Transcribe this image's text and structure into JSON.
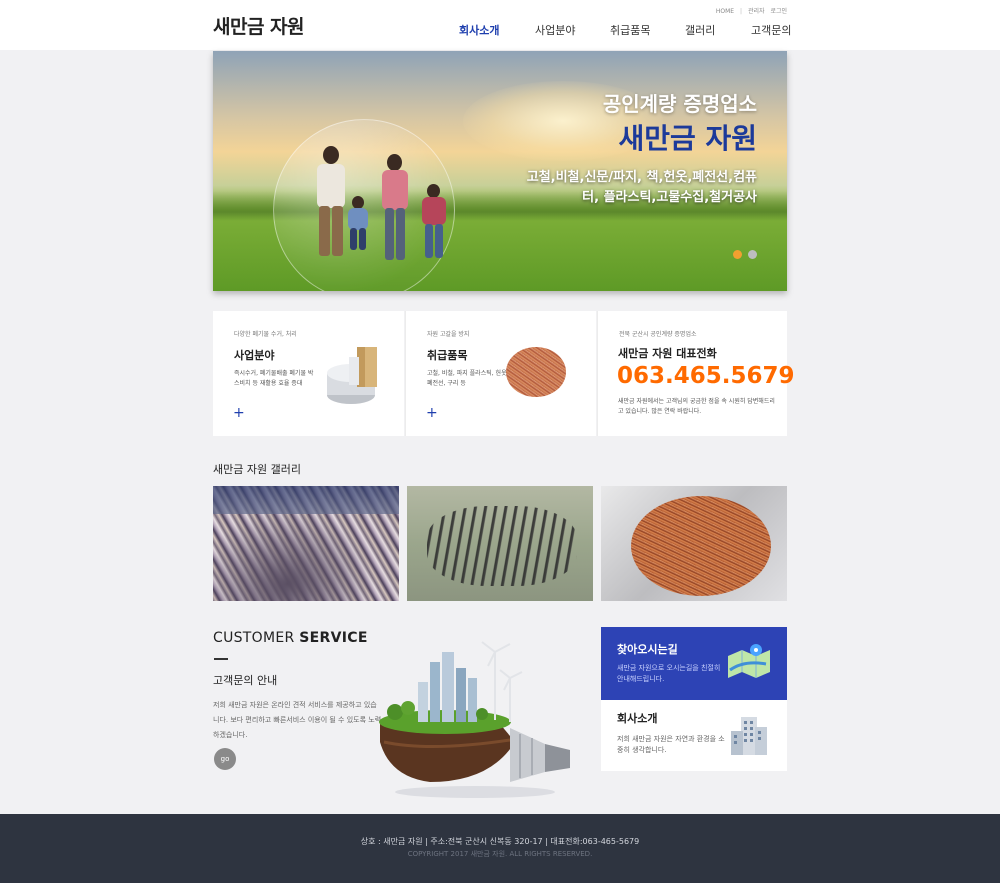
{
  "header": {
    "logo": "새만금 자원",
    "util": {
      "home": "HOME",
      "sep": "|",
      "admin": "관리자",
      "login": "로그인"
    },
    "nav": [
      "회사소개",
      "사업분야",
      "취급품목",
      "갤러리",
      "고객문의"
    ],
    "active_nav": 0
  },
  "banner": {
    "line1": "공인계량 증명업소",
    "line2": "새만금 자원",
    "line3": "고철,비철,신문/파지, 책,헌옷,폐전선,컴퓨터, 플라스틱,고물수집,철거공사",
    "dot_colors": [
      "#f0a030",
      "#bdbdbd"
    ]
  },
  "info": [
    {
      "small": "다양한 폐기물 수거, 처리",
      "title": "사업분야",
      "desc": "즉시수거, 폐기물배출 폐기물 박스비치 등 재활용 효율 증대",
      "plus": "+"
    },
    {
      "small": "자원 고갈을 방지",
      "title": "취급품목",
      "desc": "고철, 비철, 파지 플라스틱, 헌옷 폐전선, 구리 등",
      "plus": "+"
    },
    {
      "small": "전북 군산시 공인계량 증명업소",
      "title": "새만금 자원 대표전화",
      "phone": "063.465.5679",
      "desc": "새만금 자원에서는 고객님의 궁금한 점을 속 시원히 답변해드리고 있습니다. 많은 연락 바랍니다."
    }
  ],
  "gallery": {
    "title": "새만금 자원 갤러리"
  },
  "customer": {
    "head_light": "CUSTOMER ",
    "head_bold": "SERVICE",
    "sub": "고객문의 안내",
    "desc": "저희 새만금 자원은 온라인 견적 서비스를 제공하고 있습니다. 보다 편리하고 빠른서비스 이용이 될 수 있도록 노력하겠습니다.",
    "go": "go"
  },
  "cards": {
    "map": {
      "title": "찾아오시는길",
      "desc": "새만금 자원으로 오시는길을 친절히 안내해드립니다."
    },
    "about": {
      "title": "회사소개",
      "desc": "저희 새만금 자원은 자연과 환경을 소중히 생각합니다."
    }
  },
  "footer": {
    "line1": "상호 : 새만금 자원  |  주소:전북 군산시 신복동 320-17  |  대표전화:063-465-5679",
    "line2": "COPYRIGHT 2017 새만금 자원. ALL RIGHTS RESERVED."
  },
  "colors": {
    "accent": "#1f3fae",
    "phone": "#ff6a00",
    "card_blue": "#2d43b5",
    "footer": "#2e3440"
  }
}
